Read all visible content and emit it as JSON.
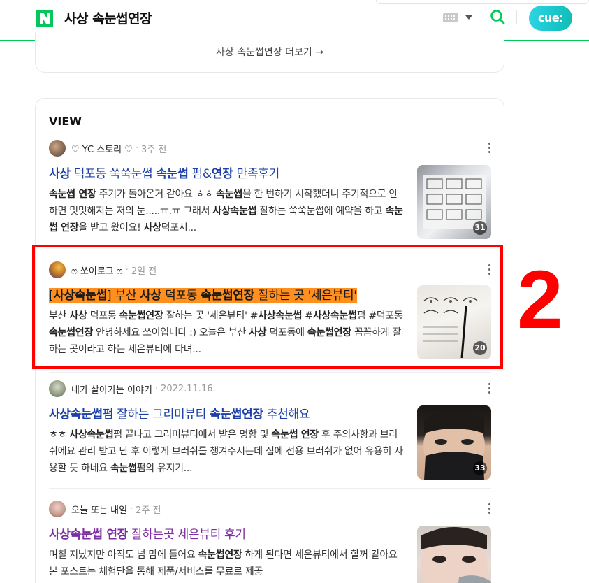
{
  "header": {
    "query": "사상 속눈썹연장",
    "cue_label": "cue:",
    "logo_letter": "N"
  },
  "more": {
    "label": "사상 속눈썹연장 더보기 →"
  },
  "view": {
    "title": "VIEW",
    "items": [
      {
        "author": "♡ YC 스토리 ♡",
        "date": "3주 전",
        "title": [
          {
            "t": "사상",
            "b": true
          },
          {
            "t": " 덕포동 쑥쑥눈썹 "
          },
          {
            "t": "속눈썹",
            "b": true
          },
          {
            "t": " 펌&"
          },
          {
            "t": "연장",
            "b": true
          },
          {
            "t": " 만족후기"
          }
        ],
        "snippet": [
          {
            "t": "속눈썹 연장",
            "b": true
          },
          {
            "t": " 주기가 돌아온거 같아요 ㅎㅎ "
          },
          {
            "t": "속눈썹",
            "b": true
          },
          {
            "t": "을 한 번하기 시작했더니 주기적으로 안하면 밋밋해지는 저의 눈.....ㅠ.ㅠ 그래서 "
          },
          {
            "t": "사상속눈썹",
            "b": true
          },
          {
            "t": " 잘하는 쑥쑥눈썹에 예약을 하고 "
          },
          {
            "t": "속눈썹 연장",
            "b": true
          },
          {
            "t": "을 받고 왔어요! "
          },
          {
            "t": "사상",
            "b": true
          },
          {
            "t": "덕포시..."
          }
        ],
        "image_count": "31"
      },
      {
        "author": "ෆ 쏘이로그 ෆ",
        "date": "2일 전",
        "title": [
          {
            "t": "[",
            "hl": true
          },
          {
            "t": "사상속눈썹",
            "b": true,
            "hl": true
          },
          {
            "t": "] 부산 ",
            "hl": true
          },
          {
            "t": "사상",
            "b": true,
            "hl": true
          },
          {
            "t": " 덕포동 ",
            "hl": true
          },
          {
            "t": "속눈썹연장",
            "b": true,
            "hl": true
          },
          {
            "t": " 잘하는 곳 '세은뷰티'",
            "hl": true
          }
        ],
        "snippet": [
          {
            "t": "부산 "
          },
          {
            "t": "사상",
            "b": true
          },
          {
            "t": " 덕포동 "
          },
          {
            "t": "속눈썹연장",
            "b": true
          },
          {
            "t": " 잘하는 곳 '세은뷰티' #"
          },
          {
            "t": "사상속눈썹",
            "b": true
          },
          {
            "t": " #"
          },
          {
            "t": "사상속눈썹",
            "b": true
          },
          {
            "t": "펌 #덕포동"
          },
          {
            "t": "속눈썹연장",
            "b": true
          },
          {
            "t": " 안녕하세요 쏘이입니다 :) 오늘은 부산 "
          },
          {
            "t": "사상",
            "b": true
          },
          {
            "t": " 덕포동에 "
          },
          {
            "t": "속눈썹연장",
            "b": true
          },
          {
            "t": " 꼼꼼하게 잘하는 곳이라고 하는 세은뷰티에 다녀..."
          }
        ],
        "image_count": "20"
      },
      {
        "author": "내가 살아가는 이야기",
        "date": "2022.11.16.",
        "title": [
          {
            "t": "사상속눈썹",
            "b": true
          },
          {
            "t": "펌 잘하는 그리미뷰티 "
          },
          {
            "t": "속눈썹연장",
            "b": true
          },
          {
            "t": " 추천해요"
          }
        ],
        "snippet": [
          {
            "t": "ㅎㅎ "
          },
          {
            "t": "사상속눈썹",
            "b": true
          },
          {
            "t": "펌 끝나고 그리미뷰티에서 받은 명함 및 "
          },
          {
            "t": "속눈썹 연장",
            "b": true
          },
          {
            "t": " 후 주의사항과 브러쉬에요 관리 받고 난 후 이렇게 브러쉬를 챙겨주시는데 집에 전용 브러쉬가 없어 유용히 사용할 듯 하네요 "
          },
          {
            "t": "속눈썹",
            "b": true
          },
          {
            "t": "펌의 유지기..."
          }
        ],
        "image_count": "33"
      },
      {
        "author": "오늘 또는 내일",
        "date": "2주 전",
        "visited": true,
        "title": [
          {
            "t": "사상속눈썹 연장",
            "b": true
          },
          {
            "t": " 잘하는곳 세은뷰티 후기"
          }
        ],
        "snippet": [
          {
            "t": "며칠 지났지만 아직도 넘 맘에 들어요 "
          },
          {
            "t": "속눈썹연장",
            "b": true
          },
          {
            "t": " 하게 된다면 세은뷰티에서 할꺼 같아요 본 포스트는 체험단을 통해 제품/서비스를 무료로 제공"
          }
        ],
        "image_count": ""
      }
    ]
  },
  "annotation": {
    "label": "2",
    "color": "#ff0000"
  },
  "colors": {
    "brand": "#03c75a",
    "title_link": "#1c3fa8",
    "visited": "#7d2fa1",
    "highlight": "#ff8f1f"
  }
}
